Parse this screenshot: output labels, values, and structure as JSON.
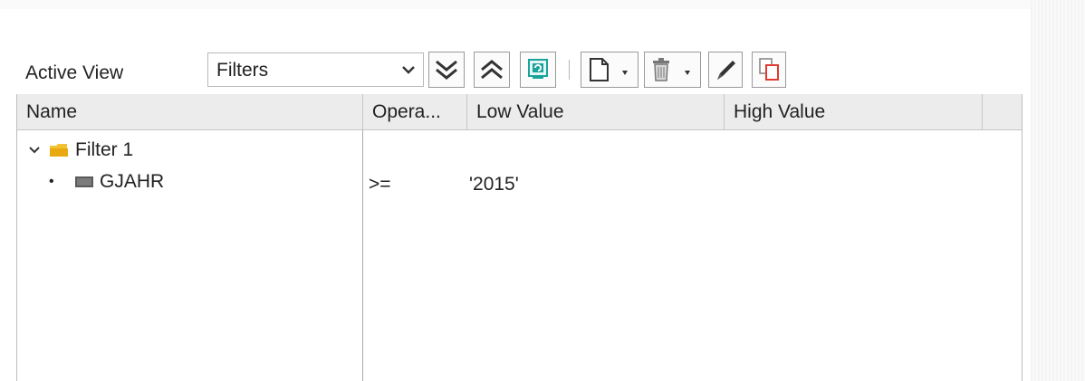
{
  "toolbar": {
    "active_view_label": "Active View",
    "view_select_value": "Filters"
  },
  "grid": {
    "headers": {
      "name": "Name",
      "operator": "Opera...",
      "low_value": "Low Value",
      "high_value": "High Value"
    },
    "tree": {
      "folder_label": "Filter 1",
      "field_label": "GJAHR"
    },
    "row": {
      "operator": ">=",
      "low_value": "'2015'",
      "high_value": ""
    }
  },
  "colors": {
    "folder": "#f2c232",
    "accent_teal": "#1aa39a",
    "accent_red": "#e23a2e",
    "header_bg": "#ececec"
  }
}
